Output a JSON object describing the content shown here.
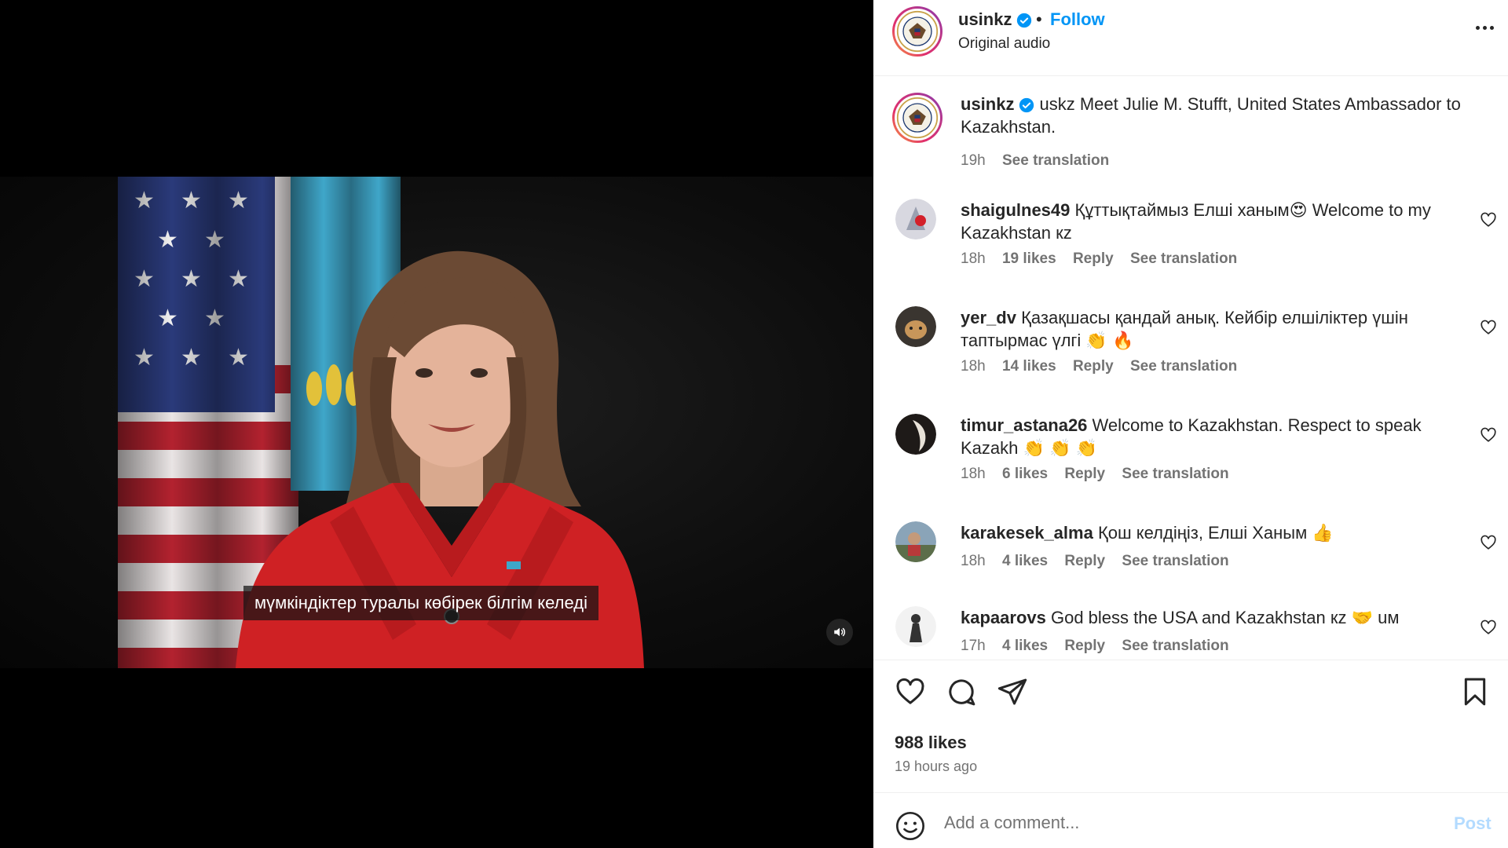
{
  "video": {
    "caption": "мүмкіндіктер туралы көбірек білгім келеді"
  },
  "header": {
    "username": "usinkz",
    "separator": "•",
    "follow_label": "Follow",
    "audio_label": "Original audio"
  },
  "post": {
    "username": "usinkz",
    "text": "uskz Meet Julie M. Stufft, United States Ambassador to Kazakhstan.",
    "time": "19h",
    "see_translation": "See translation"
  },
  "comments": [
    {
      "username": "shaigulnes49",
      "text": "Құттықтаймыз Елші ханым😍 Welcome to my Kazakhstan кz",
      "time": "18h",
      "likes": "19 likes",
      "reply": "Reply",
      "see_translation": "See translation"
    },
    {
      "username": "yer_dv",
      "text": "Қазақшасы қандай анық. Кейбір елшіліктер үшін таптырмас үлгі 👏 🔥",
      "time": "18h",
      "likes": "14 likes",
      "reply": "Reply",
      "see_translation": "See translation"
    },
    {
      "username": "timur_astana26",
      "text": "Welcome to Kazakhstan. Respect to speak Kazakh 👏 👏 👏",
      "time": "18h",
      "likes": "6 likes",
      "reply": "Reply",
      "see_translation": "See translation"
    },
    {
      "username": "karakesek_alma",
      "text": "Қош келдіңіз, Елші Ханым 👍",
      "time": "18h",
      "likes": "4 likes",
      "reply": "Reply",
      "see_translation": "See translation"
    },
    {
      "username": "kapaarovs",
      "text": "God bless the USA and Kazakhstan кz 🤝 uм",
      "time": "17h",
      "likes": "4 likes",
      "reply": "Reply",
      "see_translation": "See translation"
    }
  ],
  "actions": {
    "likes": "988 likes",
    "time_ago": "19 hours ago"
  },
  "comment_box": {
    "placeholder": "Add a comment...",
    "post_label": "Post"
  },
  "colors": {
    "accent": "#0095f6",
    "post_disabled": "#b3dbff",
    "muted": "#737373"
  }
}
